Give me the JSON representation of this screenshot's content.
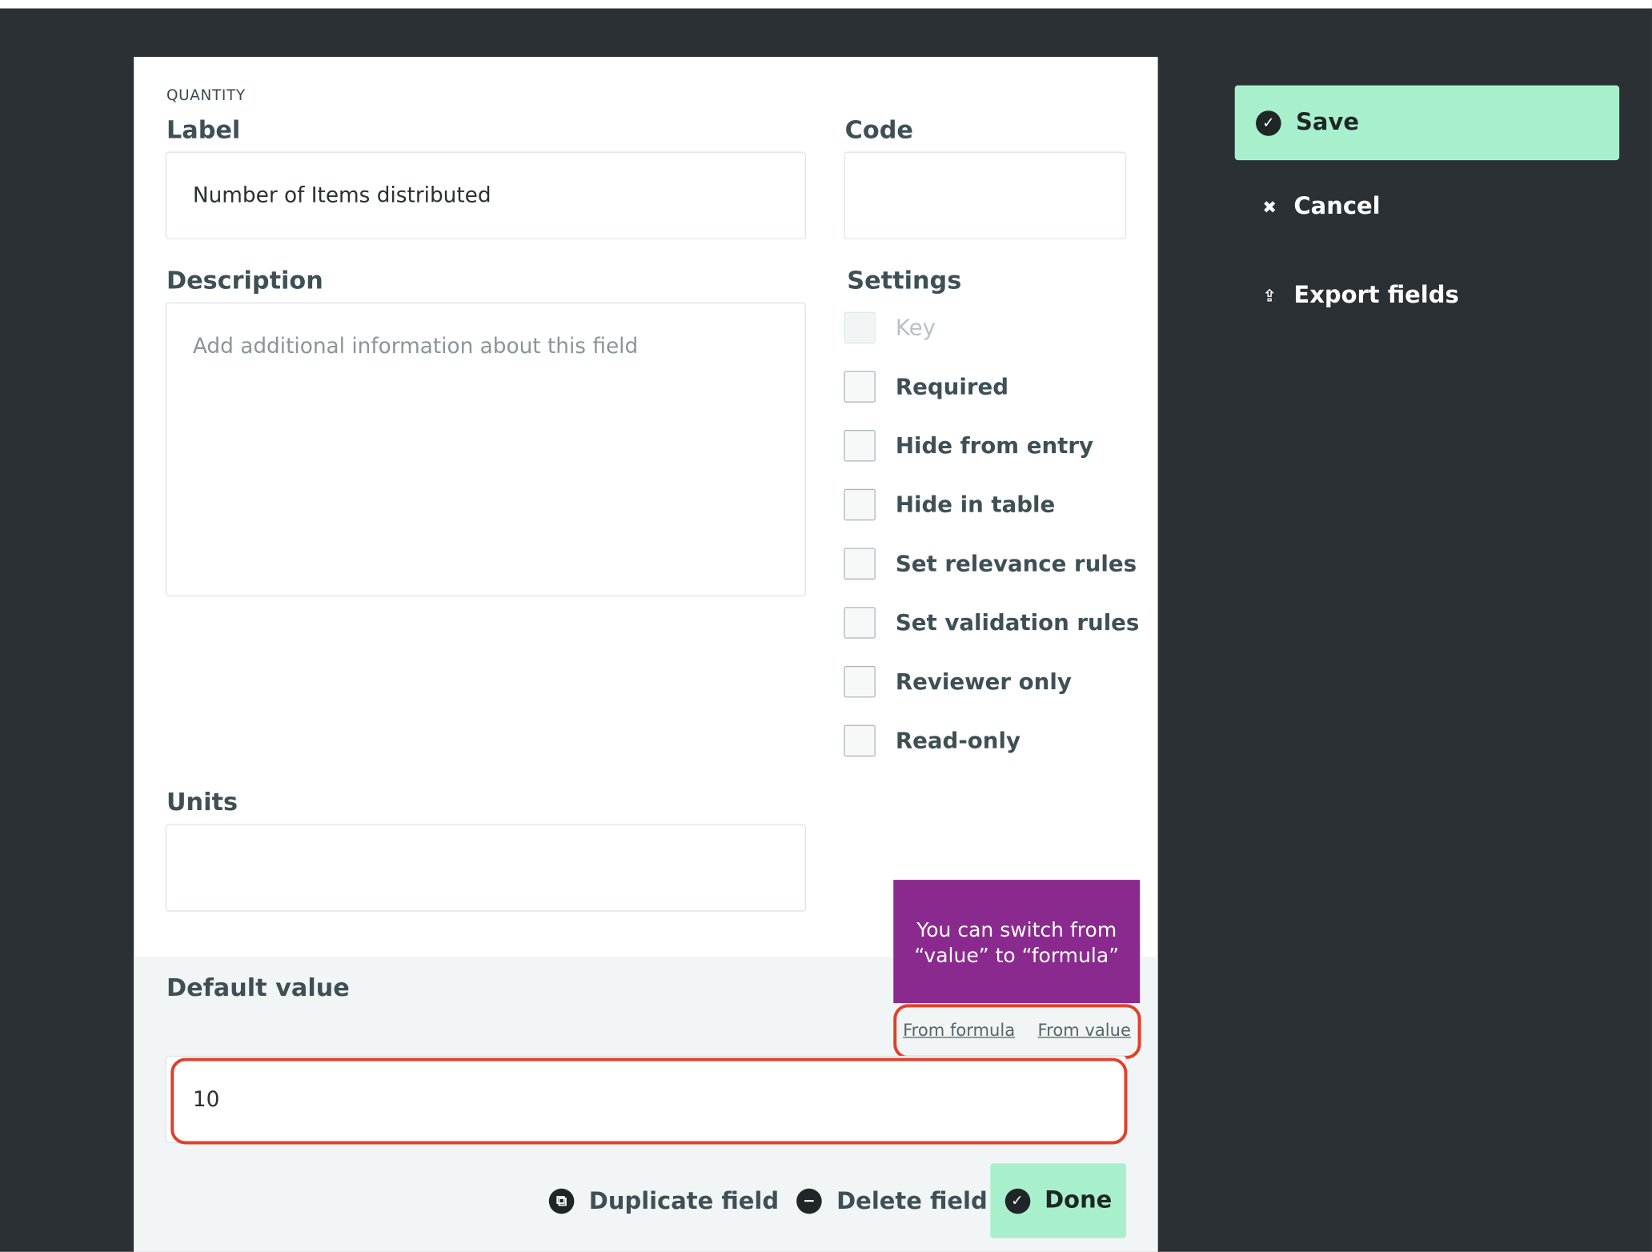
{
  "sidebar": {
    "save_label": "Save",
    "cancel_label": "Cancel",
    "export_label": "Export fields"
  },
  "field": {
    "type": "QUANTITY",
    "label_title": "Label",
    "label_value": "Number of Items distributed",
    "code_title": "Code",
    "code_value": "",
    "description_title": "Description",
    "description_placeholder": "Add additional information about this field",
    "units_title": "Units",
    "units_value": ""
  },
  "settings": {
    "title": "Settings",
    "options": [
      {
        "label": "Key",
        "checked": false,
        "disabled": true
      },
      {
        "label": "Required",
        "checked": false,
        "disabled": false
      },
      {
        "label": "Hide from entry",
        "checked": false,
        "disabled": false
      },
      {
        "label": "Hide in table",
        "checked": false,
        "disabled": false
      },
      {
        "label": "Set relevance rules",
        "checked": false,
        "disabled": false
      },
      {
        "label": "Set validation rules",
        "checked": false,
        "disabled": false
      },
      {
        "label": "Reviewer only",
        "checked": false,
        "disabled": false
      },
      {
        "label": "Read-only",
        "checked": false,
        "disabled": false
      }
    ]
  },
  "default_value": {
    "title": "Default value",
    "from_formula_label": "From formula",
    "from_value_label": "From value",
    "value": "10"
  },
  "callout": {
    "line1": "You can switch from",
    "line2": "“value” to “formula”",
    "color": "#8b2a8e"
  },
  "actions": {
    "duplicate_label": "Duplicate field",
    "delete_label": "Delete field",
    "done_label": "Done"
  },
  "colors": {
    "background": "#2a3033",
    "accent_green": "#a8f0cc",
    "highlight_red": "#e0402a"
  }
}
